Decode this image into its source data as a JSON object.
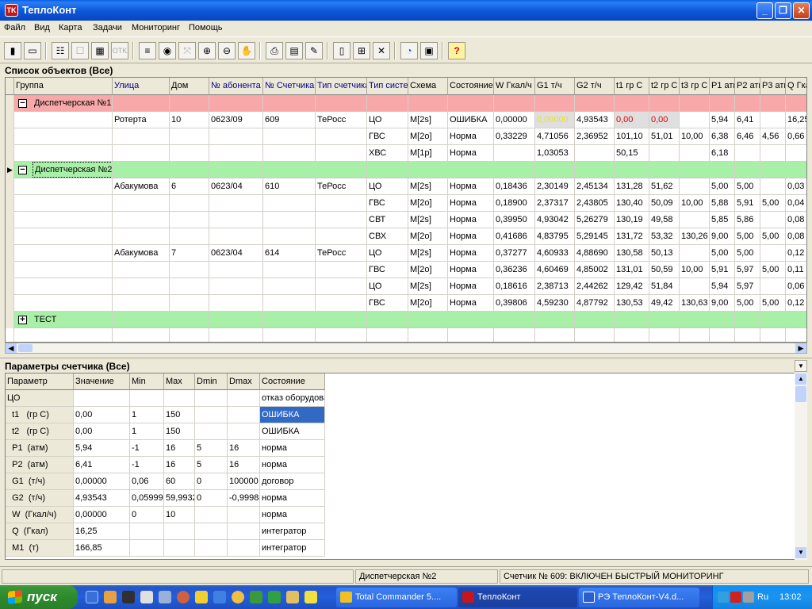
{
  "window": {
    "title": "ТеплоКонт",
    "minimize": "_",
    "maximize": "❐",
    "close": "✕"
  },
  "menu": [
    "Файл",
    "Вид",
    "Карта",
    "Задачи",
    "Мониторинг",
    "Помощь"
  ],
  "toolbar": {
    "otk_label": "OTK",
    "help_label": "?"
  },
  "objects_panel": {
    "title": "Список объектов (Все)",
    "columns": [
      "Группа",
      "Улица",
      "Дом",
      "№ абонента",
      "№ Счетчика",
      "Тип счетчика",
      "Тип системы",
      "Схема",
      "Состояние",
      "W Гкал/ч",
      "G1 т/ч",
      "G2 т/ч",
      "t1 гр С",
      "t2 гр С",
      "t3 гр С",
      "P1 атм",
      "P2 атм",
      "P3 атм",
      "Q Гкал"
    ],
    "groups": [
      {
        "name": "Диспетчерская №1",
        "expand_symbol": "−",
        "color": "#f8a8a8"
      },
      {
        "name": "Диспетчерская №2",
        "expand_symbol": "−",
        "color": "#a8f0a8"
      },
      {
        "name": "ТЕСТ",
        "expand_symbol": "+",
        "color": "#a8f0a8"
      }
    ],
    "rows": [
      [
        "",
        "Ротерта",
        "10",
        "0623/09",
        "609",
        "ТеРосс",
        "ЦО",
        "M[2s]",
        "ОШИБКА",
        "0,00000",
        "0,00000",
        "4,93543",
        "0,00",
        "0,00",
        "",
        "5,94",
        "6,41",
        "",
        "16,25"
      ],
      [
        "",
        "",
        "",
        "",
        "",
        "",
        "ГВС",
        "M[2o]",
        "Норма",
        "0,33229",
        "4,71056",
        "2,36952",
        "101,10",
        "51,01",
        "10,00",
        "6,38",
        "6,46",
        "4,56",
        "0,66"
      ],
      [
        "",
        "",
        "",
        "",
        "",
        "",
        "ХВС",
        "M[1p]",
        "Норма",
        "",
        "1,03053",
        "",
        "50,15",
        "",
        "",
        "6,18",
        "",
        "",
        ""
      ],
      [
        "",
        "Абакумова",
        "6",
        "0623/04",
        "610",
        "ТеРосс",
        "ЦО",
        "M[2s]",
        "Норма",
        "0,18436",
        "2,30149",
        "2,45134",
        "131,28",
        "51,62",
        "",
        "5,00",
        "5,00",
        "",
        "0,03"
      ],
      [
        "",
        "",
        "",
        "",
        "",
        "",
        "ГВС",
        "M[2o]",
        "Норма",
        "0,18900",
        "2,37317",
        "2,43805",
        "130,40",
        "50,09",
        "10,00",
        "5,88",
        "5,91",
        "5,00",
        "0,04"
      ],
      [
        "",
        "",
        "",
        "",
        "",
        "",
        "СВТ",
        "M[2s]",
        "Норма",
        "0,39950",
        "4,93042",
        "5,26279",
        "130,19",
        "49,58",
        "",
        "5,85",
        "5,86",
        "",
        "0,08"
      ],
      [
        "",
        "",
        "",
        "",
        "",
        "",
        "СВХ",
        "M[2o]",
        "Норма",
        "0,41686",
        "4,83795",
        "5,29145",
        "131,72",
        "53,32",
        "130,26",
        "9,00",
        "5,00",
        "5,00",
        "0,08"
      ],
      [
        "",
        "Абакумова",
        "7",
        "0623/04",
        "614",
        "ТеРосс",
        "ЦО",
        "M[2s]",
        "Норма",
        "0,37277",
        "4,60933",
        "4,88690",
        "130,58",
        "50,13",
        "",
        "5,00",
        "5,00",
        "",
        "0,12"
      ],
      [
        "",
        "",
        "",
        "",
        "",
        "",
        "ГВС",
        "M[2o]",
        "Норма",
        "0,36236",
        "4,60469",
        "4,85002",
        "131,01",
        "50,59",
        "10,00",
        "5,91",
        "5,97",
        "5,00",
        "0,11"
      ],
      [
        "",
        "",
        "",
        "",
        "",
        "",
        "ЦО",
        "M[2s]",
        "Норма",
        "0,18616",
        "2,38713",
        "2,44262",
        "129,42",
        "51,84",
        "",
        "5,94",
        "5,97",
        "",
        "0,06"
      ],
      [
        "",
        "",
        "",
        "",
        "",
        "",
        "ГВС",
        "M[2o]",
        "Норма",
        "0,39806",
        "4,59230",
        "4,87792",
        "130,53",
        "49,42",
        "130,63",
        "9,00",
        "5,00",
        "5,00",
        "0,12"
      ]
    ]
  },
  "params_panel": {
    "title": "Параметры счетчика (Все)",
    "columns": [
      "Параметр",
      "Значение",
      "Min",
      "Max",
      "Dmin",
      "Dmax",
      "Состояние"
    ],
    "rows": [
      [
        "ЦО",
        "",
        "",
        "",
        "",
        "",
        "отказ оборудования"
      ],
      [
        "  t1   (гр С)",
        "0,00",
        "1",
        "150",
        "",
        "",
        "ОШИБКА"
      ],
      [
        "  t2   (гр С)",
        "0,00",
        "1",
        "150",
        "",
        "",
        "ОШИБКА"
      ],
      [
        "  P1  (атм)",
        "5,94",
        "-1",
        "16",
        "5",
        "16",
        "норма"
      ],
      [
        "  P2  (атм)",
        "6,41",
        "-1",
        "16",
        "5",
        "16",
        "норма"
      ],
      [
        "  G1  (т/ч)",
        "0,00000",
        "0,06",
        "60",
        "0",
        "100000",
        "договор"
      ],
      [
        "  G2  (т/ч)",
        "4,93543",
        "0,05999",
        "59,9932",
        "0",
        "-0,99988",
        "норма"
      ],
      [
        "  W  (Гкал/ч)",
        "0,00000",
        "0",
        "10",
        "",
        "",
        "норма"
      ],
      [
        "  Q  (Гкал)",
        "16,25",
        "",
        "",
        "",
        "",
        "интегратор"
      ],
      [
        "  M1  (т)",
        "166,85",
        "",
        "",
        "",
        "",
        "интегратор"
      ]
    ]
  },
  "status": {
    "panel1": "",
    "panel2": "Диспетчерская №2",
    "panel3": "Счетчик № 609: ВКЛЮЧЕН БЫСТРЫЙ МОНИТОРИНГ"
  },
  "taskbar": {
    "start": "пуск",
    "tasks": [
      "Total Commander 5....",
      "ТеплоКонт",
      "РЭ ТеплоКонт-V4.d..."
    ],
    "lang": "Ru",
    "clock": "13:02"
  },
  "colors": {
    "accent": "#0a56d8",
    "group_error": "#f8a8a8",
    "group_ok": "#a8f0a8",
    "error_text": "#e00000",
    "selection": "#316ac5"
  }
}
